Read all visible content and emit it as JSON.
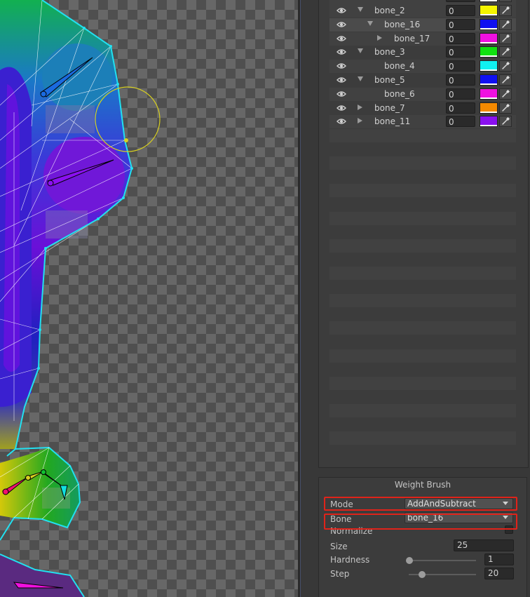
{
  "hierarchy": {
    "rows": [
      {
        "name": "bone_2",
        "value": "0",
        "color": "#f5f500",
        "expand": "down"
      },
      {
        "name": "bone_16",
        "value": "0",
        "color": "#1010f0",
        "expand": "down"
      },
      {
        "name": "bone_17",
        "value": "0",
        "color": "#f010e0",
        "expand": "right"
      },
      {
        "name": "bone_3",
        "value": "0",
        "color": "#10e010",
        "expand": "down"
      },
      {
        "name": "bone_4",
        "value": "0",
        "color": "#10f0f0",
        "expand": "none"
      },
      {
        "name": "bone_5",
        "value": "0",
        "color": "#1010f0",
        "expand": "down"
      },
      {
        "name": "bone_6",
        "value": "0",
        "color": "#f010e0",
        "expand": "none"
      },
      {
        "name": "bone_7",
        "value": "0",
        "color": "#f58a00",
        "expand": "right"
      },
      {
        "name": "bone_11",
        "value": "0",
        "color": "#8a10f0",
        "expand": "right"
      }
    ],
    "icons": {
      "visibility": "eye-icon",
      "picker": "eyedropper-icon"
    }
  },
  "weight_brush": {
    "title": "Weight Brush",
    "mode_label": "Mode",
    "mode_value": "AddAndSubtract",
    "bone_label": "Bone",
    "bone_value": "bone_16",
    "normalize_label": "Normalize",
    "size_label": "Size",
    "size_value": "25",
    "hardness_label": "Hardness",
    "hardness_value": "1",
    "hardness_level": 0.01,
    "step_label": "Step",
    "step_value": "20",
    "step_level": 0.2
  },
  "colors": {
    "highlight": "#e0231a",
    "mesh_outline": "#22e0f0",
    "brush_cursor": "#d8d020"
  }
}
